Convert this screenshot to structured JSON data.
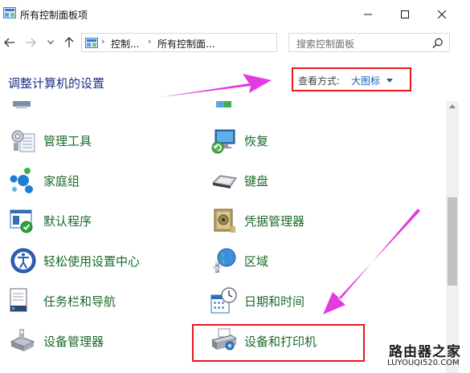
{
  "window": {
    "title": "所有控制面板项"
  },
  "address": {
    "segments": [
      "控制...",
      "所有控制面..."
    ]
  },
  "search": {
    "placeholder": "搜索控制面板"
  },
  "heading": "调整计算机的设置",
  "view_by": {
    "label": "查看方式:",
    "value": "大图标"
  },
  "items": [
    {
      "label": "管理工具",
      "icon": "admin-tools-icon"
    },
    {
      "label": "恢复",
      "icon": "recovery-icon"
    },
    {
      "label": "家庭组",
      "icon": "homegroup-icon"
    },
    {
      "label": "键盘",
      "icon": "keyboard-icon"
    },
    {
      "label": "默认程序",
      "icon": "default-programs-icon"
    },
    {
      "label": "凭据管理器",
      "icon": "credential-manager-icon"
    },
    {
      "label": "轻松使用设置中心",
      "icon": "ease-of-access-icon"
    },
    {
      "label": "区域",
      "icon": "region-icon"
    },
    {
      "label": "任务栏和导航",
      "icon": "taskbar-icon"
    },
    {
      "label": "日期和时间",
      "icon": "date-time-icon"
    },
    {
      "label": "设备管理器",
      "icon": "device-manager-icon"
    },
    {
      "label": "设备和打印机",
      "icon": "devices-printers-icon"
    }
  ],
  "watermark": {
    "cn": "路由器之家",
    "en": "LUYOUQI520.COM"
  },
  "colors": {
    "heading": "#1e3287",
    "item_label": "#1a6b2a",
    "link": "#1a5fb4",
    "highlight": "#e8161f",
    "arrow": "#e23be0"
  }
}
